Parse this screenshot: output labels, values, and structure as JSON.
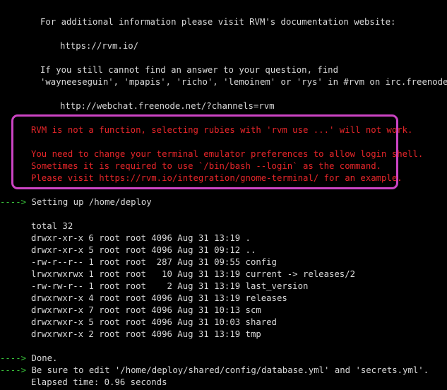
{
  "terminal": {
    "help_lines": [
      "For additional information please visit RVM's documentation website:",
      "https://rvm.io/",
      "If you still cannot find an answer to your question, find",
      "'wayneeseguin', 'mpapis', 'richo', 'lemoinem' or 'rys' in #rvm on irc.freenode.net:",
      "http://webchat.freenode.net/?channels=rvm"
    ],
    "warning": {
      "line1": "RVM is not a function, selecting rubies with 'rvm use ...' will not work.",
      "line2": "You need to change your terminal emulator preferences to allow login shell.",
      "line3": "Sometimes it is required to use `/bin/bash --login` as the command.",
      "line4": "Please visit https://rvm.io/integration/gnome-terminal/ for an example."
    },
    "arrow": "---->",
    "setup_text": "Setting up /home/deploy",
    "listing": [
      "total 32",
      "drwxr-xr-x 6 root root 4096 Aug 31 13:19 .",
      "drwxr-xr-x 5 root root 4096 Aug 31 09:12 ..",
      "-rw-r--r-- 1 root root  287 Aug 31 09:55 config",
      "lrwxrwxrwx 1 root root   10 Aug 31 13:19 current -> releases/2",
      "-rw-rw-r-- 1 root root    2 Aug 31 13:19 last_version",
      "drwxrwxr-x 4 root root 4096 Aug 31 13:19 releases",
      "drwxrwxr-x 7 root root 4096 Aug 31 10:13 scm",
      "drwxrwxr-x 5 root root 4096 Aug 31 10:03 shared",
      "drwxrwxr-x 2 root root 4096 Aug 31 13:19 tmp"
    ],
    "done_text": "Done.",
    "edit_text": "Be sure to edit '/home/deploy/shared/config/database.yml' and 'secrets.yml'.",
    "elapsed": "Elapsed time: 0.96 seconds"
  },
  "colors": {
    "background": "#000000",
    "text": "#d9d9d9",
    "error": "#e8262a",
    "arrow": "#38c23a",
    "highlight_border": "#cc44c4"
  }
}
